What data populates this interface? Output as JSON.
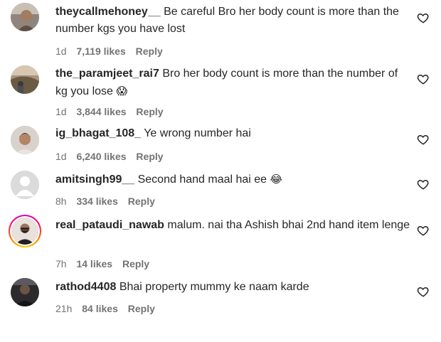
{
  "comments": [
    {
      "username": "theycallmehoney__",
      "text": "Be careful Bro her body count is more than the number kgs you have lost",
      "emoji": "",
      "time": "1d",
      "likes": "7,119 likes",
      "reply": "Reply",
      "avatar_color": "#9a8e85"
    },
    {
      "username": "the_paramjeet_rai7",
      "text": "Bro her body count is more than the number of kg you lose",
      "emoji": "😱",
      "time": "1d",
      "likes": "3,844 likes",
      "reply": "Reply",
      "avatar_color": "#7a6a55"
    },
    {
      "username": "ig_bhagat_108_",
      "text": "Ye wrong number hai",
      "emoji": "",
      "time": "1d",
      "likes": "6,240 likes",
      "reply": "Reply",
      "avatar_color": "#a89886"
    },
    {
      "username": "amitsingh99__",
      "text": "Second hand maal hai ee",
      "emoji": "😂",
      "time": "8h",
      "likes": "334 likes",
      "reply": "Reply",
      "avatar_color": "#dbdbdb"
    },
    {
      "username": "real_pataudi_nawab",
      "text": "malum. nai tha Ashish bhai 2nd hand item lenge",
      "emoji": "",
      "time": "7h",
      "likes": "14 likes",
      "reply": "Reply",
      "avatar_color": "#c9b8ad"
    },
    {
      "username": "rathod4408",
      "text": "Bhai property mummy ke naam karde",
      "emoji": "",
      "time": "21h",
      "likes": "84 likes",
      "reply": "Reply",
      "avatar_color": "#3a3a3a"
    }
  ],
  "icons": {
    "like": "heart-outline-icon",
    "default_avatar": "default-avatar-icon"
  },
  "colors": {
    "text": "#262626",
    "meta": "#737373",
    "story_ring": [
      "#d300c5",
      "#ff0069",
      "#ff7a00",
      "#ffd600"
    ]
  }
}
